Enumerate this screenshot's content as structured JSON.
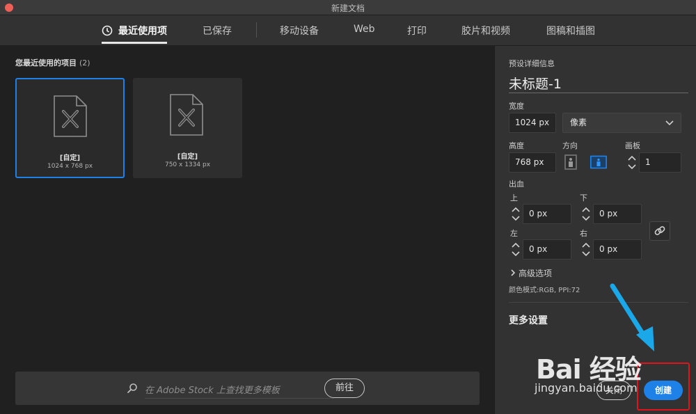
{
  "window": {
    "title": "新建文档"
  },
  "tabs": [
    {
      "label": "最近使用项",
      "active": true
    },
    {
      "label": "已保存"
    },
    {
      "label": "移动设备"
    },
    {
      "label": "Web"
    },
    {
      "label": "打印"
    },
    {
      "label": "胶片和视频"
    },
    {
      "label": "图稿和插图"
    }
  ],
  "recent": {
    "title": "您最近使用的项目",
    "count": "(2)",
    "items": [
      {
        "name": "[自定]",
        "dims": "1024 x 768 px",
        "selected": true
      },
      {
        "name": "[自定]",
        "dims": "750 x 1334 px",
        "selected": false
      }
    ]
  },
  "search": {
    "placeholder": "在 Adobe Stock 上查找更多模板",
    "button": "前往"
  },
  "preset": {
    "heading": "预设详细信息",
    "doc_title": "未标题-1",
    "width_label": "宽度",
    "width": "1024 px",
    "unit": "像素",
    "height_label": "高度",
    "height": "768 px",
    "orientation_label": "方向",
    "artboards_label": "画板",
    "artboards": "1",
    "bleed_label": "出血",
    "top_label": "上",
    "top": "0 px",
    "bottom_label": "下",
    "bottom": "0 px",
    "left_label": "左",
    "left": "0 px",
    "right_label": "右",
    "right": "0 px",
    "advanced": "高级选项",
    "color_mode": "颜色模式:RGB, PPI:72",
    "more_settings": "更多设置",
    "close_button": "关闭",
    "create_button": "创建"
  },
  "watermark": {
    "logo": "Bai 经验",
    "url": "jingyan.baidu.com"
  },
  "colors": {
    "accent": "#1e81e8",
    "highlight_box": "#e0141e",
    "arrow": "#1aa8e8"
  }
}
